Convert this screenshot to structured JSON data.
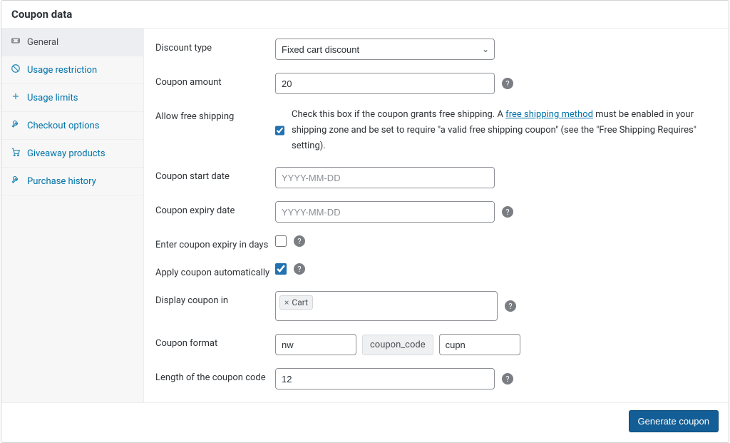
{
  "header": {
    "title": "Coupon data"
  },
  "sidebar": {
    "items": [
      {
        "label": "General"
      },
      {
        "label": "Usage restriction"
      },
      {
        "label": "Usage limits"
      },
      {
        "label": "Checkout options"
      },
      {
        "label": "Giveaway products"
      },
      {
        "label": "Purchase history"
      }
    ]
  },
  "form": {
    "discount_type": {
      "label": "Discount type",
      "value": "Fixed cart discount"
    },
    "coupon_amount": {
      "label": "Coupon amount",
      "value": "20"
    },
    "free_shipping": {
      "label": "Allow free shipping",
      "checked": true,
      "desc_before": "Check this box if the coupon grants free shipping. A ",
      "desc_link": "free shipping method",
      "desc_after": " must be enabled in your shipping zone and be set to require \"a valid free shipping coupon\" (see the \"Free Shipping Requires\" setting)."
    },
    "start_date": {
      "label": "Coupon start date",
      "placeholder": "YYYY-MM-DD",
      "value": ""
    },
    "expiry_date": {
      "label": "Coupon expiry date",
      "placeholder": "YYYY-MM-DD",
      "value": ""
    },
    "expiry_days": {
      "label": "Enter coupon expiry in days",
      "checked": false
    },
    "auto_apply": {
      "label": "Apply coupon automatically",
      "checked": true
    },
    "display_in": {
      "label": "Display coupon in",
      "tag": "Cart"
    },
    "format": {
      "label": "Coupon format",
      "prefix": "nw",
      "code_chip": "coupon_code",
      "suffix": "cupn"
    },
    "length": {
      "label": "Length of the coupon code",
      "value": "12"
    }
  },
  "footer": {
    "generate": "Generate coupon"
  },
  "glyph": {
    "help": "?",
    "close": "×",
    "chevron": "⌄"
  }
}
